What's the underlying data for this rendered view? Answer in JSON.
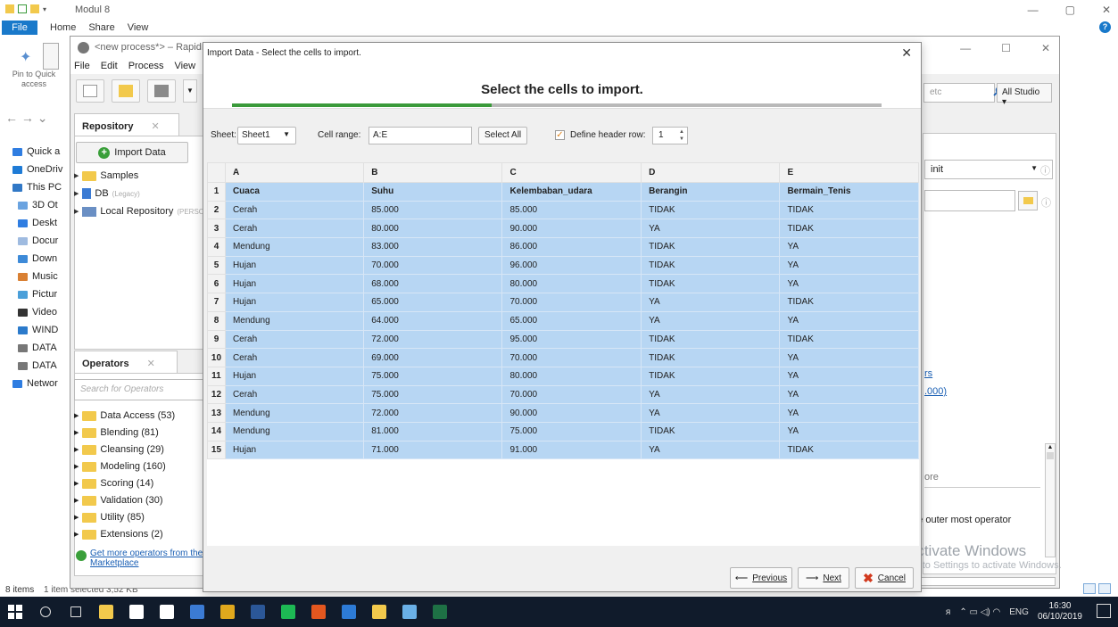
{
  "explorer": {
    "title": "Modul 8",
    "tabs": [
      "File",
      "Home",
      "Share",
      "View"
    ],
    "pin_label": "Pin to Quick access",
    "sidebar": [
      "Quick a",
      "OneDriv",
      "This PC",
      "3D Ot",
      "Deskt",
      "Docur",
      "Down",
      "Music",
      "Pictur",
      "Video",
      "WIND",
      "DATA",
      "DATA",
      "Networ"
    ],
    "sidebar_colors": [
      "#2f7de1",
      "#1e7bd6",
      "#3178c6",
      "#6aa3e0",
      "#2f7de1",
      "#9fbbe0",
      "#3d8ad8",
      "#d98033",
      "#4a9fd9",
      "#333333",
      "#2b7acb",
      "#777777",
      "#777777",
      "#2f7de1"
    ],
    "status_left": "8 items",
    "status_right": "1 item selected  3,52 KB"
  },
  "studio": {
    "title": "<new process*> – RapidMine",
    "menu": [
      "File",
      "Edit",
      "Process",
      "View",
      "C"
    ],
    "search_placeholder": "etc",
    "perspective": "All Studio ▾",
    "repo_tab": "Repository",
    "import_btn": "Import Data",
    "repo_tree": [
      {
        "label": "Samples",
        "type": "folder"
      },
      {
        "label": "DB",
        "note": "(Legacy)",
        "type": "db"
      },
      {
        "label": "Local Repository",
        "note": "(PERSONA",
        "type": "repo"
      }
    ],
    "operators_tab": "Operators",
    "operators_search": "Search for Operators",
    "operators": [
      "Data Access (53)",
      "Blending (81)",
      "Cleansing (29)",
      "Modeling (160)",
      "Scoring (14)",
      "Validation (30)",
      "Utility (85)",
      "Extensions (2)"
    ],
    "marketplace_link": [
      "Get more operators from the",
      "Marketplace"
    ],
    "right_panel": {
      "dropdown_value": "init",
      "link1": "rs",
      "link2": ".000)",
      "text_ore": "ore",
      "text_outer": "the outer most operator"
    },
    "watermark": [
      "Activate Windows",
      "Go to Settings to activate Windows."
    ]
  },
  "dialog": {
    "title": "Import Data - Select the cells to import.",
    "heading": "Select the cells to import.",
    "progress": 0.4,
    "sheet_label": "Sheet:",
    "sheet_value": "Sheet1",
    "cell_range_label": "Cell range:",
    "cell_range_value": "A:E",
    "select_all": "Select All",
    "define_header_label": "Define header row:",
    "define_header_checked": true,
    "header_row_value": "1",
    "columns": [
      "A",
      "B",
      "C",
      "D",
      "E"
    ],
    "rows": [
      [
        "Cuaca",
        "Suhu",
        "Kelembaban_udara",
        "Berangin",
        "Bermain_Tenis"
      ],
      [
        "Cerah",
        "85.000",
        "85.000",
        "TIDAK",
        "TIDAK"
      ],
      [
        "Cerah",
        "80.000",
        "90.000",
        "YA",
        "TIDAK"
      ],
      [
        "Mendung",
        "83.000",
        "86.000",
        "TIDAK",
        "YA"
      ],
      [
        "Hujan",
        "70.000",
        "96.000",
        "TIDAK",
        "YA"
      ],
      [
        "Hujan",
        "68.000",
        "80.000",
        "TIDAK",
        "YA"
      ],
      [
        "Hujan",
        "65.000",
        "70.000",
        "YA",
        "TIDAK"
      ],
      [
        "Mendung",
        "64.000",
        "65.000",
        "YA",
        "YA"
      ],
      [
        "Cerah",
        "72.000",
        "95.000",
        "TIDAK",
        "TIDAK"
      ],
      [
        "Cerah",
        "69.000",
        "70.000",
        "TIDAK",
        "YA"
      ],
      [
        "Hujan",
        "75.000",
        "80.000",
        "TIDAK",
        "YA"
      ],
      [
        "Cerah",
        "75.000",
        "70.000",
        "YA",
        "YA"
      ],
      [
        "Mendung",
        "72.000",
        "90.000",
        "YA",
        "YA"
      ],
      [
        "Mendung",
        "81.000",
        "75.000",
        "TIDAK",
        "YA"
      ],
      [
        "Hujan",
        "71.000",
        "91.000",
        "YA",
        "TIDAK"
      ]
    ],
    "previous": "Previous",
    "next": "Next",
    "cancel": "Cancel"
  },
  "taskbar": {
    "icons": [
      {
        "name": "search-icon",
        "color": "#101b2b"
      },
      {
        "name": "task-view-icon",
        "color": "#101b2b"
      },
      {
        "name": "file-explorer-icon",
        "color": "#f2c94c"
      },
      {
        "name": "store-icon",
        "color": "#ffffff"
      },
      {
        "name": "mail-icon",
        "color": "#ffffff"
      },
      {
        "name": "app-check-icon",
        "color": "#3b7bd4"
      },
      {
        "name": "chrome-icon",
        "color": "#e0a81d"
      },
      {
        "name": "word-icon",
        "color": "#2b5797"
      },
      {
        "name": "spotify-icon",
        "color": "#1db954"
      },
      {
        "name": "app-orange-icon",
        "color": "#e3571f"
      },
      {
        "name": "app-blue-icon",
        "color": "#2d7bd6"
      },
      {
        "name": "app-yellow-icon",
        "color": "#f2c94c"
      },
      {
        "name": "app-lightblue-icon",
        "color": "#6ab0e6"
      },
      {
        "name": "excel-icon",
        "color": "#1e7145"
      }
    ],
    "lang": "ENG",
    "time": "16:30",
    "date": "06/10/2019"
  }
}
